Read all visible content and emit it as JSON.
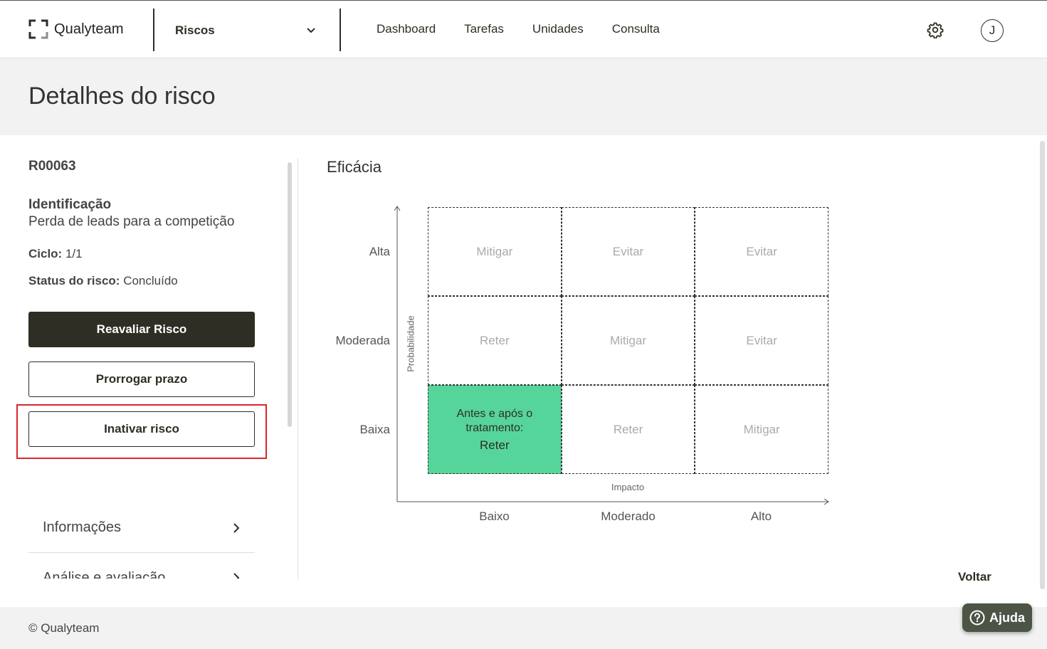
{
  "header": {
    "logo_text": "Qualyteam",
    "module_label": "Riscos",
    "nav": [
      "Dashboard",
      "Tarefas",
      "Unidades",
      "Consulta"
    ],
    "user_initial": "J"
  },
  "page_title": "Detalhes do risco",
  "risk": {
    "code": "R00063",
    "identification_label": "Identificação",
    "identification_value": "Perda de leads para a competição",
    "cycle_label": "Ciclo:",
    "cycle_value": "1/1",
    "status_label": "Status do risco:",
    "status_value": "Concluído"
  },
  "actions": {
    "reassess": "Reavaliar Risco",
    "extend": "Prorrogar prazo",
    "deactivate": "Inativar risco"
  },
  "accordion": [
    "Informações",
    "Análise e avaliação"
  ],
  "matrix": {
    "title": "Eficácia",
    "y_axis_title": "Probabilidade",
    "x_axis_title": "Impacto",
    "y_labels": [
      "Alta",
      "Moderada",
      "Baixa"
    ],
    "x_labels": [
      "Baixo",
      "Moderado",
      "Alto"
    ],
    "rows": [
      [
        "Mitigar",
        "Evitar",
        "Evitar"
      ],
      [
        "Reter",
        "Mitigar",
        "Evitar"
      ],
      [
        "Reter",
        "Reter",
        "Mitigar"
      ]
    ],
    "active_cell_title": "Antes e após o tratamento:",
    "active_color": "#56d59b"
  },
  "back_label": "Voltar",
  "footer": {
    "copyright": "© Qualyteam"
  },
  "help_label": "Ajuda"
}
